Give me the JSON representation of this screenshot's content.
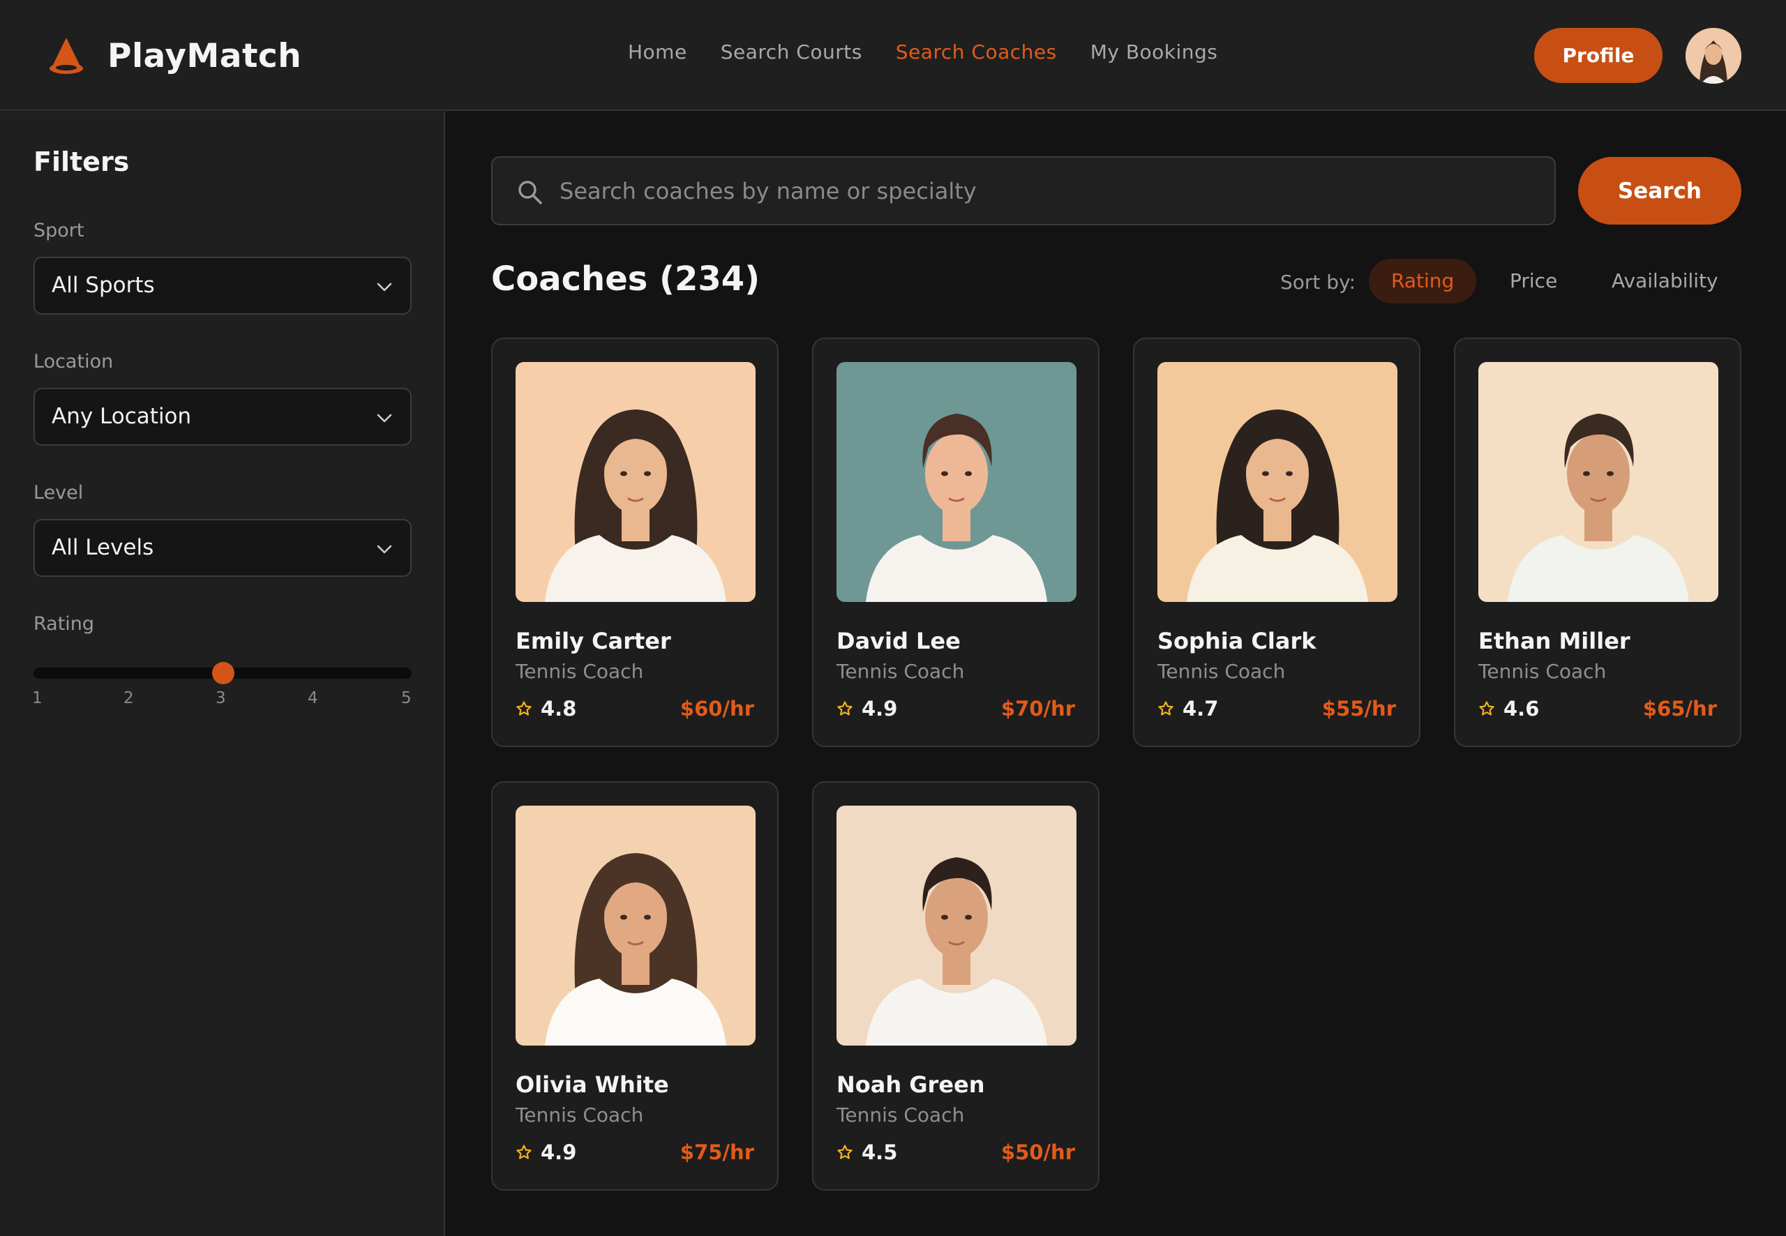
{
  "app": {
    "name": "PlayMatch"
  },
  "nav": {
    "items": [
      {
        "label": "Home",
        "active": false
      },
      {
        "label": "Search Courts",
        "active": false
      },
      {
        "label": "Search Coaches",
        "active": true
      },
      {
        "label": "My Bookings",
        "active": false
      }
    ],
    "profile_label": "Profile"
  },
  "filters": {
    "title": "Filters",
    "sport": {
      "label": "Sport",
      "value": "All Sports"
    },
    "location": {
      "label": "Location",
      "value": "Any Location"
    },
    "level": {
      "label": "Level",
      "value": "All Levels"
    },
    "rating": {
      "label": "Rating",
      "ticks": [
        "1",
        "2",
        "3",
        "4",
        "5"
      ],
      "value": 3
    }
  },
  "search": {
    "placeholder": "Search coaches by name or specialty",
    "button_label": "Search"
  },
  "results": {
    "title": "Coaches (234)",
    "sort_label": "Sort by:",
    "sort_options": [
      {
        "label": "Rating",
        "active": true
      },
      {
        "label": "Price",
        "active": false
      },
      {
        "label": "Availability",
        "active": false
      }
    ]
  },
  "coaches": [
    {
      "name": "Emily Carter",
      "role": "Tennis Coach",
      "rating": "4.8",
      "price": "$60/hr",
      "photo_bg": "#f6cfaa",
      "hair": "#3a2a22",
      "skin": "#eab890",
      "shirt": "#f7f3ec",
      "gender": "f"
    },
    {
      "name": "David Lee",
      "role": "Tennis Coach",
      "rating": "4.9",
      "price": "$70/hr",
      "photo_bg": "#6f9895",
      "hair": "#4a2f26",
      "skin": "#eeb896",
      "shirt": "#f6f3ee",
      "gender": "m"
    },
    {
      "name": "Sophia Clark",
      "role": "Tennis Coach",
      "rating": "4.7",
      "price": "$55/hr",
      "photo_bg": "#f3c99c",
      "hair": "#2c221d",
      "skin": "#eab88f",
      "shirt": "#f7f1e4",
      "gender": "f"
    },
    {
      "name": "Ethan Miller",
      "role": "Tennis Coach",
      "rating": "4.6",
      "price": "$65/hr",
      "photo_bg": "#f4dfc4",
      "hair": "#3b2a22",
      "skin": "#d69e78",
      "shirt": "#f2f2ee",
      "gender": "m"
    },
    {
      "name": "Olivia White",
      "role": "Tennis Coach",
      "rating": "4.9",
      "price": "$75/hr",
      "photo_bg": "#f4d2b0",
      "hair": "#4b3426",
      "skin": "#e1a882",
      "shirt": "#fbfaf6",
      "gender": "f"
    },
    {
      "name": "Noah Green",
      "role": "Tennis Coach",
      "rating": "4.5",
      "price": "$50/hr",
      "photo_bg": "#f0dac3",
      "hair": "#2e211c",
      "skin": "#d9a27c",
      "shirt": "#f6f4f0",
      "gender": "m"
    }
  ],
  "colors": {
    "accent": "#c84f14",
    "accent_text": "#e35b1a",
    "background": "#131313",
    "panel": "#1f1f1f",
    "star": "#f2b01e"
  }
}
